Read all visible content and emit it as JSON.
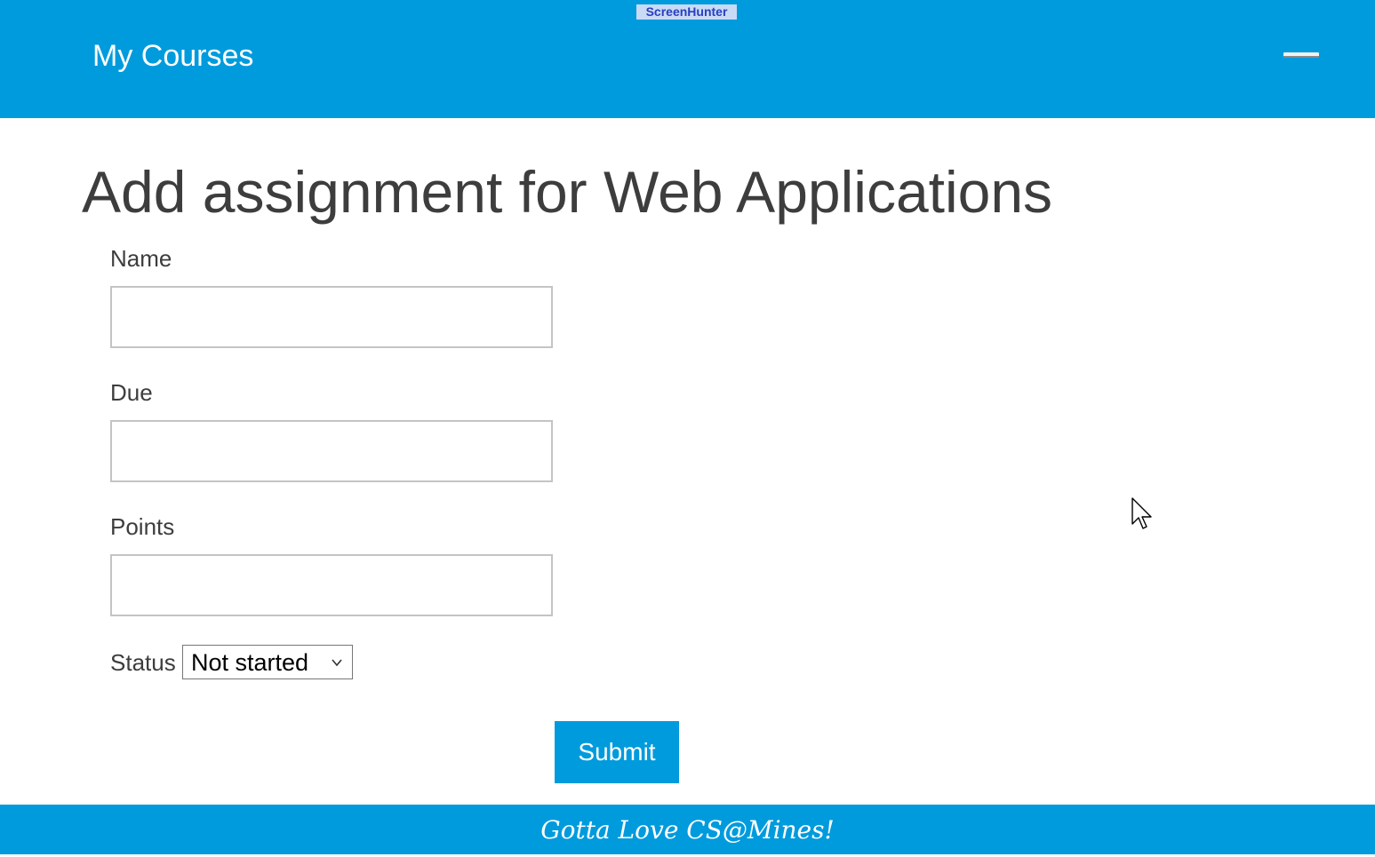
{
  "watermark": "ScreenHunter",
  "header": {
    "brand": "My Courses",
    "menu_icon": "hamburger-menu-icon"
  },
  "page": {
    "title": "Add assignment for Web Applications"
  },
  "form": {
    "name": {
      "label": "Name",
      "value": ""
    },
    "due": {
      "label": "Due",
      "value": ""
    },
    "points": {
      "label": "Points",
      "value": ""
    },
    "status": {
      "label": "Status",
      "selected": "Not started",
      "icon": "chevron-down-icon"
    },
    "submit_label": "Submit"
  },
  "footer": {
    "tagline": "Gotta Love CS@Mines!"
  },
  "colors": {
    "brand_blue": "#009bdd",
    "text": "#3d3d3d",
    "background": "#ffffff"
  }
}
